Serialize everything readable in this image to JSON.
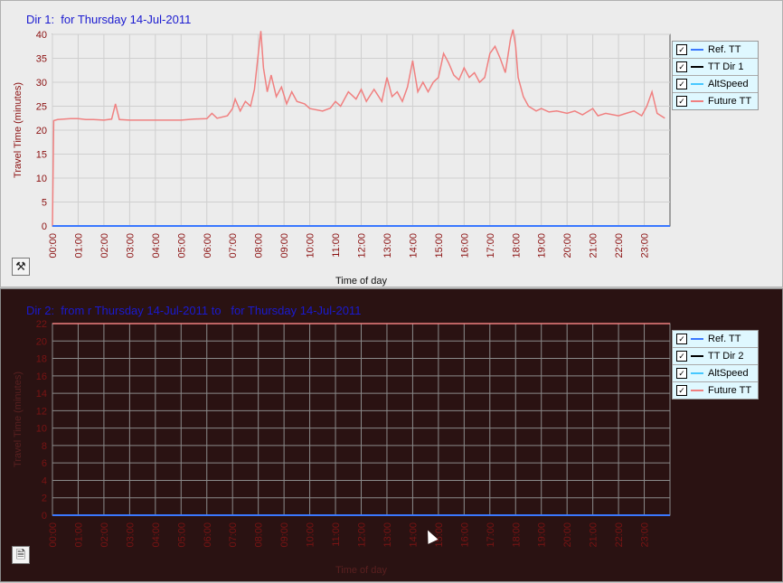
{
  "panel1": {
    "title": "Dir 1:  for Thursday 14-Jul-2011",
    "legend": [
      {
        "label": "Ref. TT",
        "color": "#3a78ff",
        "checked": "✓"
      },
      {
        "label": "TT Dir 1",
        "color": "#000000",
        "checked": "✓"
      },
      {
        "label": "AltSpeed",
        "color": "#46c8ff",
        "checked": "✓"
      },
      {
        "label": "Future TT",
        "color": "#f08080",
        "checked": "✓"
      }
    ],
    "icon": "wrench-screwdriver-icon"
  },
  "panel2": {
    "title": "Dir 2:  from r Thursday 14-Jul-2011 to   for Thursday 14-Jul-2011",
    "legend": [
      {
        "label": "Ref. TT",
        "color": "#3a78ff",
        "checked": "✓"
      },
      {
        "label": "TT Dir 2",
        "color": "#000000",
        "checked": "✓"
      },
      {
        "label": "AltSpeed",
        "color": "#46c8ff",
        "checked": "✓"
      },
      {
        "label": "Future TT",
        "color": "#f08080",
        "checked": "✓"
      }
    ],
    "icon": "document-icon"
  },
  "chart_data": [
    {
      "type": "line",
      "title": "Dir 1:  for Thursday 14-Jul-2011",
      "xlabel": "Time of day",
      "ylabel": "Travel Time (minutes)",
      "ylim": [
        0,
        40
      ],
      "yticks": [
        0,
        5,
        10,
        15,
        20,
        25,
        30,
        35,
        40
      ],
      "xlim": [
        0,
        24
      ],
      "xticks": [
        "00:00",
        "01:00",
        "02:00",
        "03:00",
        "04:00",
        "05:00",
        "06:00",
        "07:00",
        "08:00",
        "09:00",
        "10:00",
        "11:00",
        "12:00",
        "13:00",
        "14:00",
        "15:00",
        "16:00",
        "17:00",
        "18:00",
        "19:00",
        "20:00",
        "21:00",
        "22:00",
        "23:00"
      ],
      "grid": true,
      "legend_position": "right",
      "series": [
        {
          "name": "Future TT",
          "color": "#f08080",
          "x": [
            0,
            0.05,
            0.2,
            0.7,
            1.0,
            1.3,
            1.6,
            2.0,
            2.3,
            2.45,
            2.6,
            3.0,
            4.0,
            5.0,
            5.5,
            6.0,
            6.2,
            6.4,
            6.8,
            7.0,
            7.1,
            7.3,
            7.5,
            7.7,
            7.85,
            8.0,
            8.1,
            8.2,
            8.35,
            8.5,
            8.7,
            8.9,
            9.1,
            9.3,
            9.5,
            9.8,
            10.0,
            10.5,
            10.8,
            11.0,
            11.2,
            11.5,
            11.8,
            12.0,
            12.2,
            12.5,
            12.8,
            13.0,
            13.2,
            13.4,
            13.6,
            13.8,
            14.0,
            14.2,
            14.4,
            14.6,
            14.8,
            15.0,
            15.2,
            15.4,
            15.6,
            15.8,
            16.0,
            16.2,
            16.4,
            16.6,
            16.8,
            17.0,
            17.2,
            17.4,
            17.6,
            17.8,
            17.9,
            18.0,
            18.1,
            18.3,
            18.5,
            18.8,
            19.0,
            19.3,
            19.6,
            20.0,
            20.3,
            20.6,
            21.0,
            21.2,
            21.5,
            22.0,
            22.3,
            22.6,
            22.9,
            23.1,
            23.3,
            23.5,
            23.8
          ],
          "values": [
            0,
            22,
            22.2,
            22.4,
            22.4,
            22.2,
            22.2,
            22.1,
            22.3,
            25.5,
            22.2,
            22.1,
            22.1,
            22.1,
            22.3,
            22.4,
            23.5,
            22.5,
            23.0,
            24.5,
            26.5,
            24.0,
            26.0,
            25.0,
            28.5,
            36.0,
            40.7,
            33.0,
            28.0,
            31.5,
            27.0,
            29.0,
            25.5,
            28.0,
            26.0,
            25.5,
            24.5,
            24.0,
            24.6,
            26.0,
            25.0,
            28.0,
            26.5,
            28.5,
            26.0,
            28.5,
            26.0,
            31.0,
            27.0,
            28.0,
            26.0,
            29.0,
            34.5,
            28.0,
            30.0,
            28.0,
            30.0,
            31.0,
            36.0,
            34.0,
            31.5,
            30.5,
            33.0,
            31.0,
            32.0,
            30.0,
            31.0,
            36.0,
            37.5,
            35.0,
            32.0,
            39.0,
            41.0,
            37.5,
            31.0,
            27.0,
            25.0,
            24.0,
            24.5,
            23.8,
            24.0,
            23.5,
            24.0,
            23.2,
            24.5,
            23.0,
            23.5,
            23.0,
            23.5,
            24.0,
            23.0,
            25.0,
            28.0,
            23.5,
            22.5
          ]
        },
        {
          "name": "Ref. TT",
          "color": "#3a78ff",
          "x": [
            0,
            24
          ],
          "values": [
            0,
            0
          ]
        }
      ]
    },
    {
      "type": "line",
      "title": "Dir 2:  from r Thursday 14-Jul-2011 to   for Thursday 14-Jul-2011",
      "xlabel": "Time of day",
      "ylabel": "Travel Time (minutes)",
      "ylim": [
        0,
        22
      ],
      "yticks": [
        0,
        2,
        4,
        6,
        8,
        10,
        12,
        14,
        16,
        18,
        20,
        22
      ],
      "xlim": [
        0,
        24
      ],
      "xticks": [
        "00:00",
        "01:00",
        "02:00",
        "03:00",
        "04:00",
        "05:00",
        "06:00",
        "07:00",
        "08:00",
        "09:00",
        "10:00",
        "11:00",
        "12:00",
        "13:00",
        "14:00",
        "15:00",
        "16:00",
        "17:00",
        "18:00",
        "19:00",
        "20:00",
        "21:00",
        "22:00",
        "23:00"
      ],
      "grid": true,
      "legend_position": "right",
      "series": [
        {
          "name": "Future TT",
          "color": "#f08080",
          "x": [
            0,
            24
          ],
          "values": [
            22,
            22
          ]
        },
        {
          "name": "Ref. TT",
          "color": "#3a78ff",
          "x": [
            0,
            24
          ],
          "values": [
            0,
            0
          ]
        }
      ]
    }
  ]
}
